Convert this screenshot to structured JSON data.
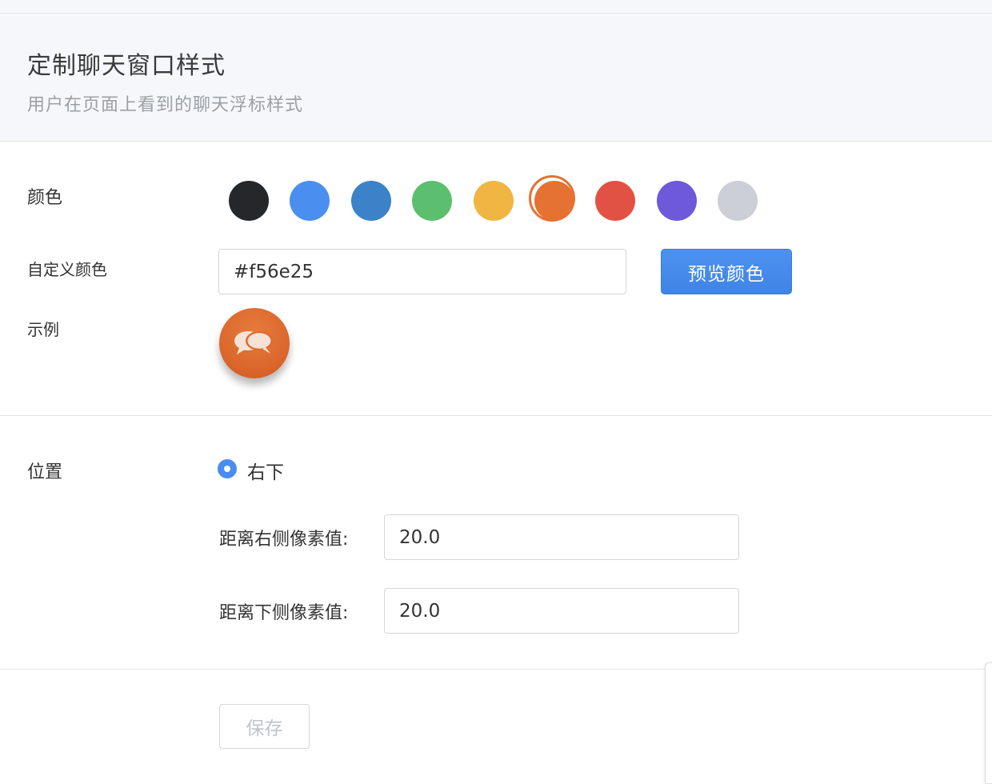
{
  "header": {
    "title": "定制聊天窗口样式",
    "subtitle": "用户在页面上看到的聊天浮标样式"
  },
  "color_section": {
    "label": "颜色",
    "swatches": [
      {
        "name": "black",
        "color": "#262729",
        "selected": false
      },
      {
        "name": "light-blue",
        "color": "#4a8ff0",
        "selected": false
      },
      {
        "name": "blue",
        "color": "#3b82c8",
        "selected": false
      },
      {
        "name": "green",
        "color": "#5bbf6f",
        "selected": false
      },
      {
        "name": "yellow",
        "color": "#f0b542",
        "selected": false
      },
      {
        "name": "orange",
        "color": "#e57132",
        "selected": true
      },
      {
        "name": "red",
        "color": "#e25244",
        "selected": false
      },
      {
        "name": "purple",
        "color": "#6d59d9",
        "selected": false
      },
      {
        "name": "gray",
        "color": "#ccd0d6",
        "selected": false
      }
    ]
  },
  "custom_color": {
    "label": "自定义颜色",
    "value": "#f56e25",
    "preview_button": "预览颜色"
  },
  "sample": {
    "label": "示例",
    "icon": "chat-bubbles-icon"
  },
  "position": {
    "label": "位置",
    "option": "右下",
    "right_label": "距离右侧像素值:",
    "right_value": "20.0",
    "bottom_label": "距离下侧像素值:",
    "bottom_value": "20.0"
  },
  "save_button": "保存"
}
